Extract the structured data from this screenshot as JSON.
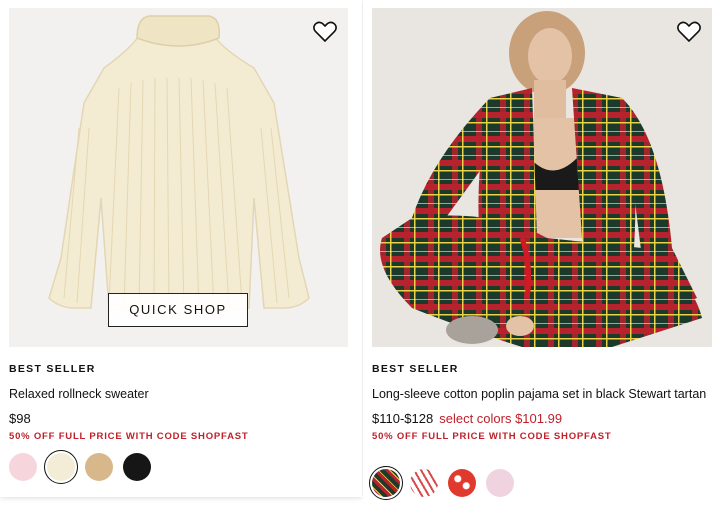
{
  "products": [
    {
      "badge": "BEST SELLER",
      "title": "Relaxed rollneck sweater",
      "price": "$98",
      "sale_price": "",
      "promo": "50% OFF FULL PRICE WITH CODE SHOPFAST",
      "quick_shop_label": "QUICK SHOP",
      "image_icon": "sweater-product-image",
      "swatches": [
        {
          "name": "pink",
          "color": "#f6d6dc"
        },
        {
          "name": "ivory",
          "color": "#f3ecd6",
          "selected": true
        },
        {
          "name": "camel",
          "color": "#d8b88a"
        },
        {
          "name": "black",
          "color": "#161616"
        }
      ]
    },
    {
      "badge": "BEST SELLER",
      "title": "Long-sleeve cotton poplin pajama set in black Stewart tartan",
      "price": "$110-$128",
      "sale_price": "select colors $101.99",
      "promo": "50% OFF FULL PRICE WITH CODE SHOPFAST",
      "image_icon": "pajama-model-product-image",
      "swatches": [
        {
          "name": "black-stewart-tartan",
          "color": "#1f3a2a",
          "selected": true
        },
        {
          "name": "red-white-stripe",
          "color": "#d94a4a"
        },
        {
          "name": "red-print",
          "color": "#e03a2e"
        },
        {
          "name": "light-pink",
          "color": "#efd3de"
        }
      ]
    }
  ],
  "colors": {
    "promo_red": "#c0202a",
    "sale_red": "#c0202a"
  }
}
